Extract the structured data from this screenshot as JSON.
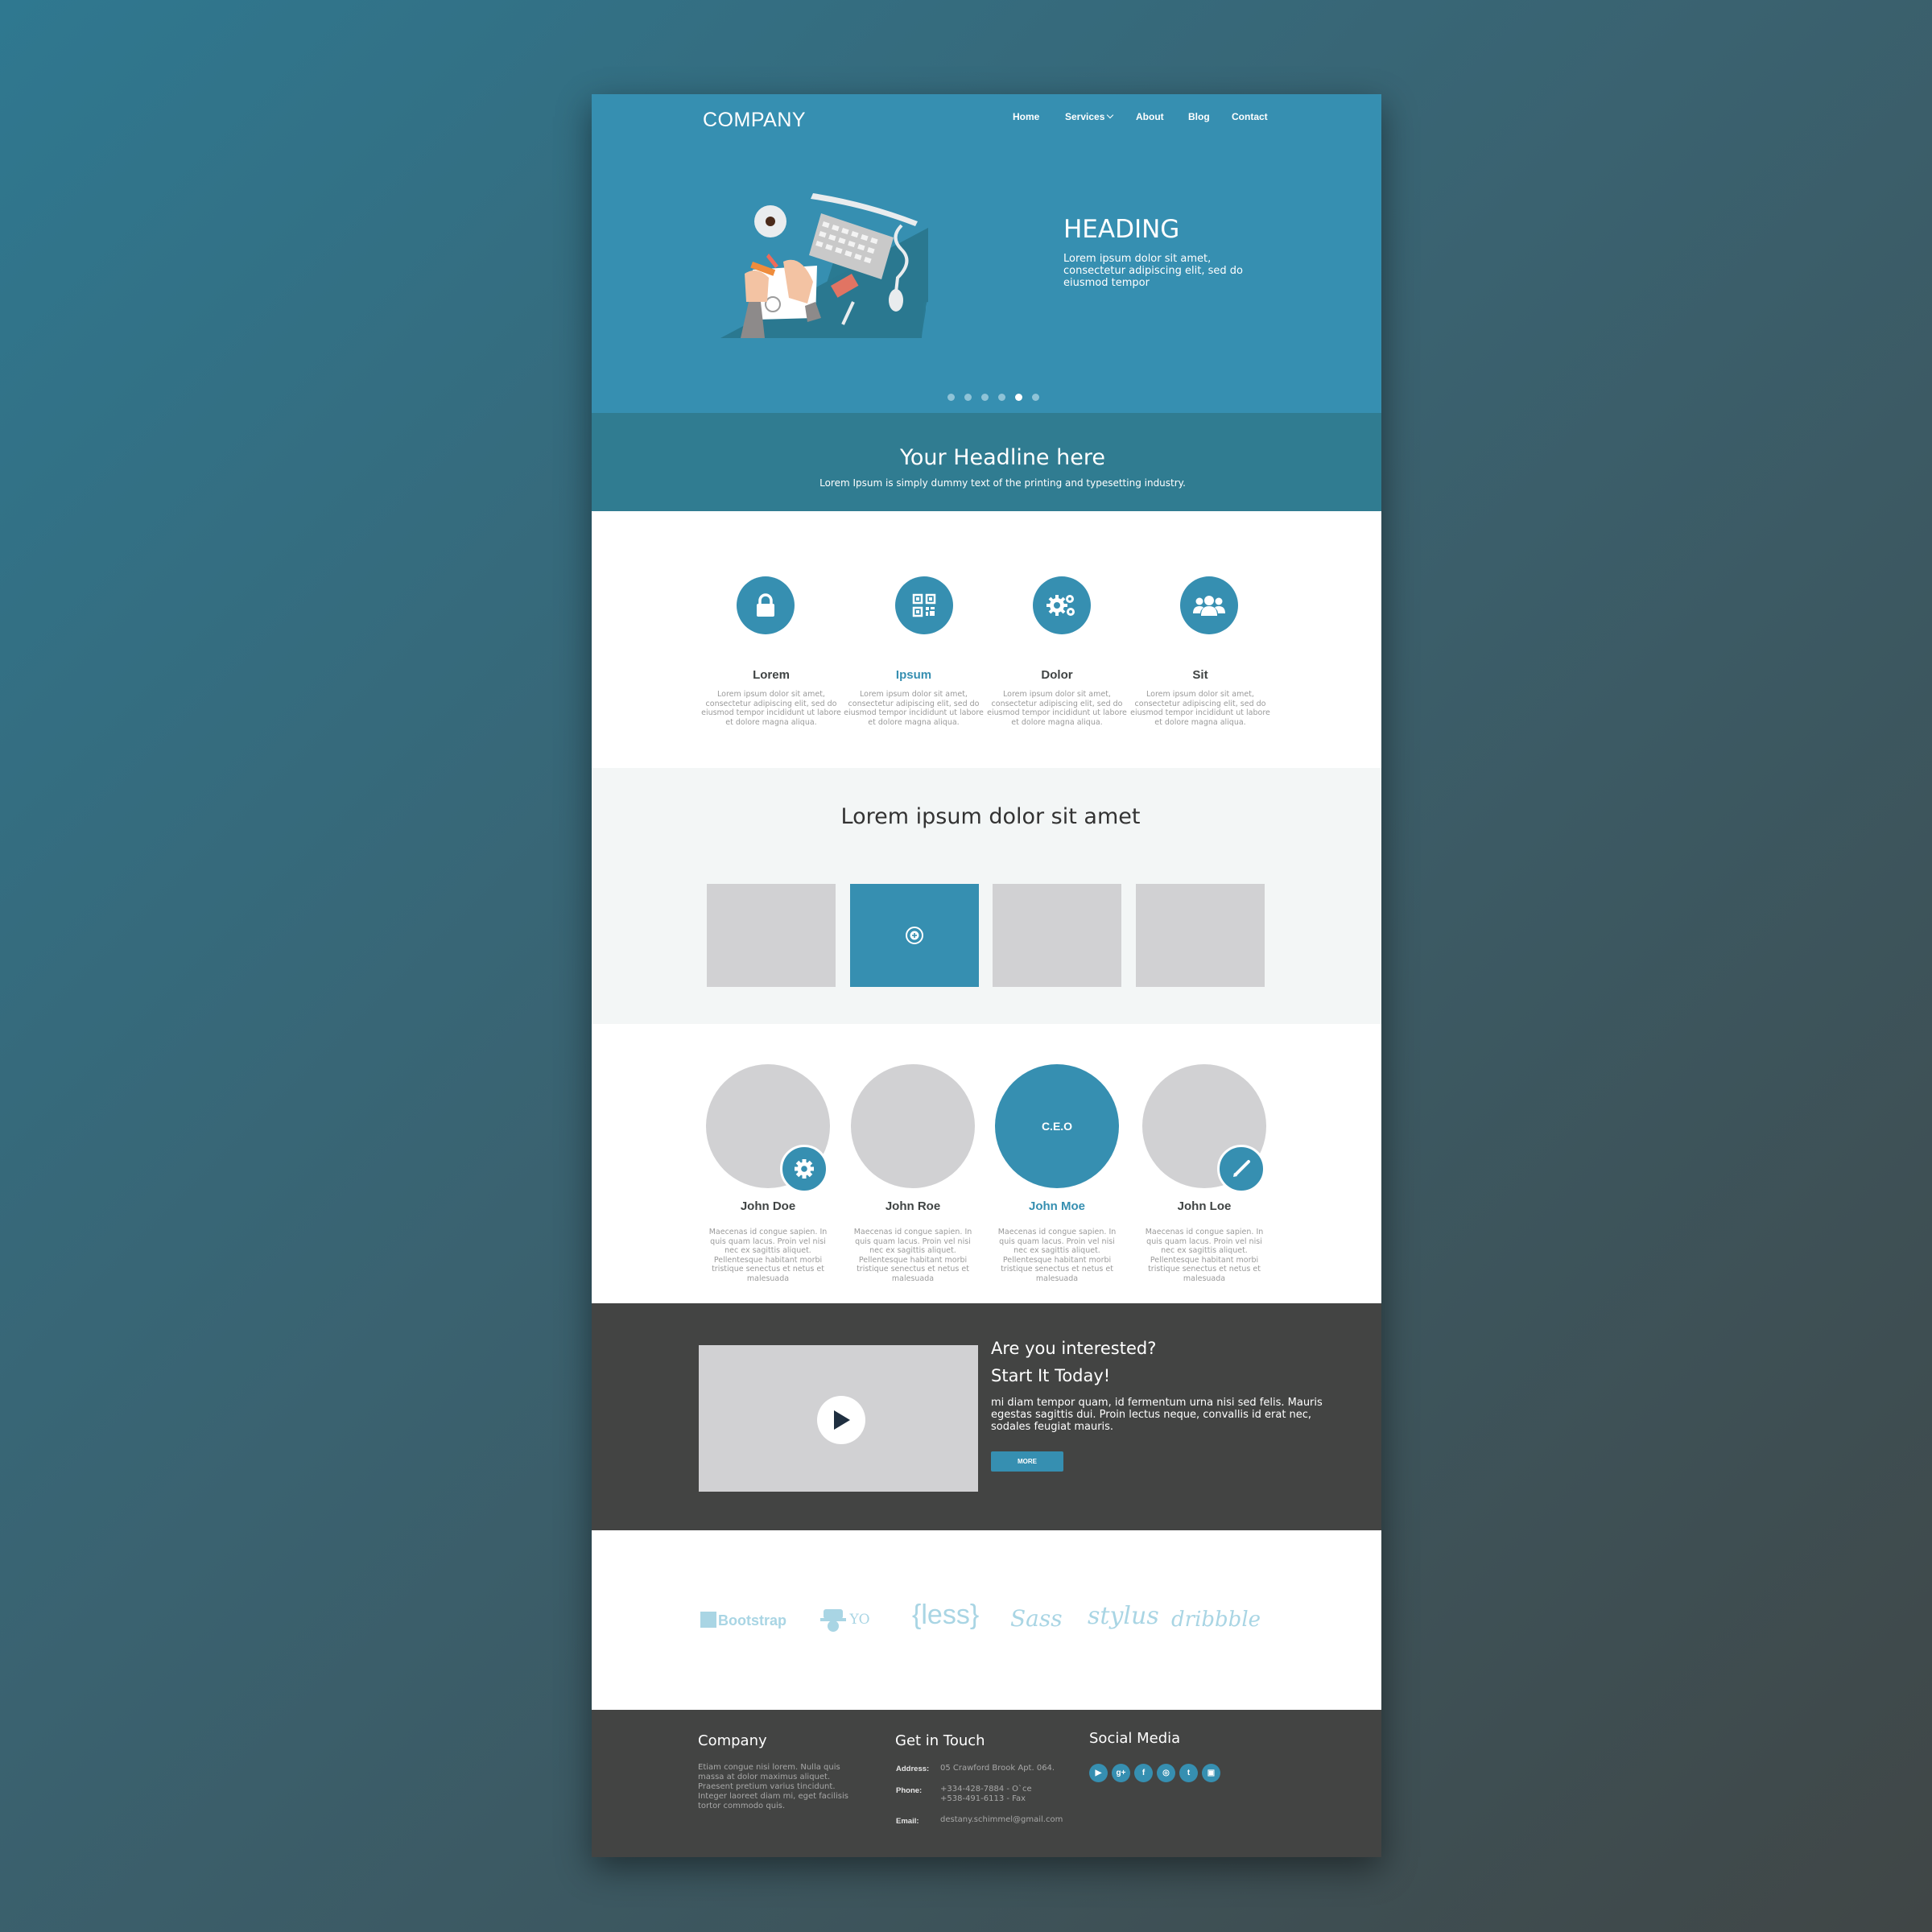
{
  "header": {
    "logo": "COMPANY",
    "nav": [
      "Home",
      "Services",
      "About",
      "Blog",
      "Contact"
    ]
  },
  "hero": {
    "heading": "HEADING",
    "text": "Lorem ipsum dolor sit amet, consectetur adipiscing elit, sed do eiusmod tempor",
    "slide_count": 6,
    "active_slide": 5
  },
  "headline": {
    "title": "Your Headline here",
    "subtitle": "Lorem Ipsum is simply dummy text of the printing and typesetting industry."
  },
  "features": [
    {
      "title": "Lorem",
      "icon": "lock-icon",
      "text": "Lorem ipsum dolor sit amet, consectetur adipiscing elit, sed do eiusmod tempor incididunt ut labore et dolore magna aliqua."
    },
    {
      "title": "Ipsum",
      "icon": "qr-code-icon",
      "text": "Lorem ipsum dolor sit amet, consectetur adipiscing elit, sed do eiusmod tempor incididunt ut labore et dolore magna aliqua."
    },
    {
      "title": "Dolor",
      "icon": "gears-icon",
      "text": "Lorem ipsum dolor sit amet, consectetur adipiscing elit, sed do eiusmod tempor incididunt ut labore et dolore magna aliqua."
    },
    {
      "title": "Sit",
      "icon": "users-icon",
      "text": "Lorem ipsum dolor sit amet, consectetur adipiscing elit, sed do eiusmod tempor incididunt ut labore et dolore magna aliqua."
    }
  ],
  "gallery": {
    "title": "Lorem ipsum dolor sit amet",
    "tiles": 4,
    "active_tile": 2
  },
  "team": [
    {
      "name": "John Doe",
      "badge": "gear-icon",
      "text": "Maecenas id congue sapien. In quis quam lacus. Proin vel nisi nec ex sagittis aliquet. Pellentesque habitant morbi tristique senectus et netus et malesuada"
    },
    {
      "name": "John Roe",
      "text": "Maecenas id congue sapien. In quis quam lacus. Proin vel nisi nec ex sagittis aliquet. Pellentesque habitant morbi tristique senectus et netus et malesuada"
    },
    {
      "name": "John Moe",
      "role": "C.E.O",
      "text": "Maecenas id congue sapien. In quis quam lacus. Proin vel nisi nec ex sagittis aliquet. Pellentesque habitant morbi tristique senectus et netus et malesuada"
    },
    {
      "name": "John Loe",
      "badge": "pencil-icon",
      "text": "Maecenas id congue sapien. In quis quam lacus. Proin vel nisi nec ex sagittis aliquet. Pellentesque habitant morbi tristique senectus et netus et malesuada"
    }
  ],
  "cta": {
    "heading1": "Are you interested?",
    "heading2": "Start It Today!",
    "text": "mi diam tempor quam, id fermentum urna nisi sed felis. Mauris egestas sagittis dui. Proin lectus neque, convallis id erat nec, sodales feugiat mauris.",
    "button": "MORE"
  },
  "brands": [
    "Bootstrap",
    "YO",
    "{less}",
    "Sass",
    "stylus",
    "dribbble"
  ],
  "footer": {
    "company_title": "Company",
    "company_text": "Etiam congue nisi lorem. Nulla quis massa at dolor maximus aliquet. Praesent pretium varius tincidunt. Integer laoreet diam mi, eget facilisis tortor commodo quis.",
    "contact_title": "Get in Touch",
    "address_label": "Address:",
    "address": "05 Crawford Brook Apt. 064.",
    "phone_label": "Phone:",
    "phone1": "+334-428-7884 - O`ce",
    "phone2": "+538-491-6113 - Fax",
    "email_label": "Email:",
    "email": "destany.schimmel@gmail.com",
    "social_title": "Social Media",
    "social": [
      "youtube-icon",
      "google-plus-icon",
      "facebook-icon",
      "dribbble-icon",
      "twitter-icon",
      "instagram-icon"
    ]
  },
  "colors": {
    "accent": "#368fb1",
    "band": "#307c91",
    "dark": "#434443",
    "placeholder": "#d1d1d3",
    "brand_logo": "#a9d5e4"
  }
}
